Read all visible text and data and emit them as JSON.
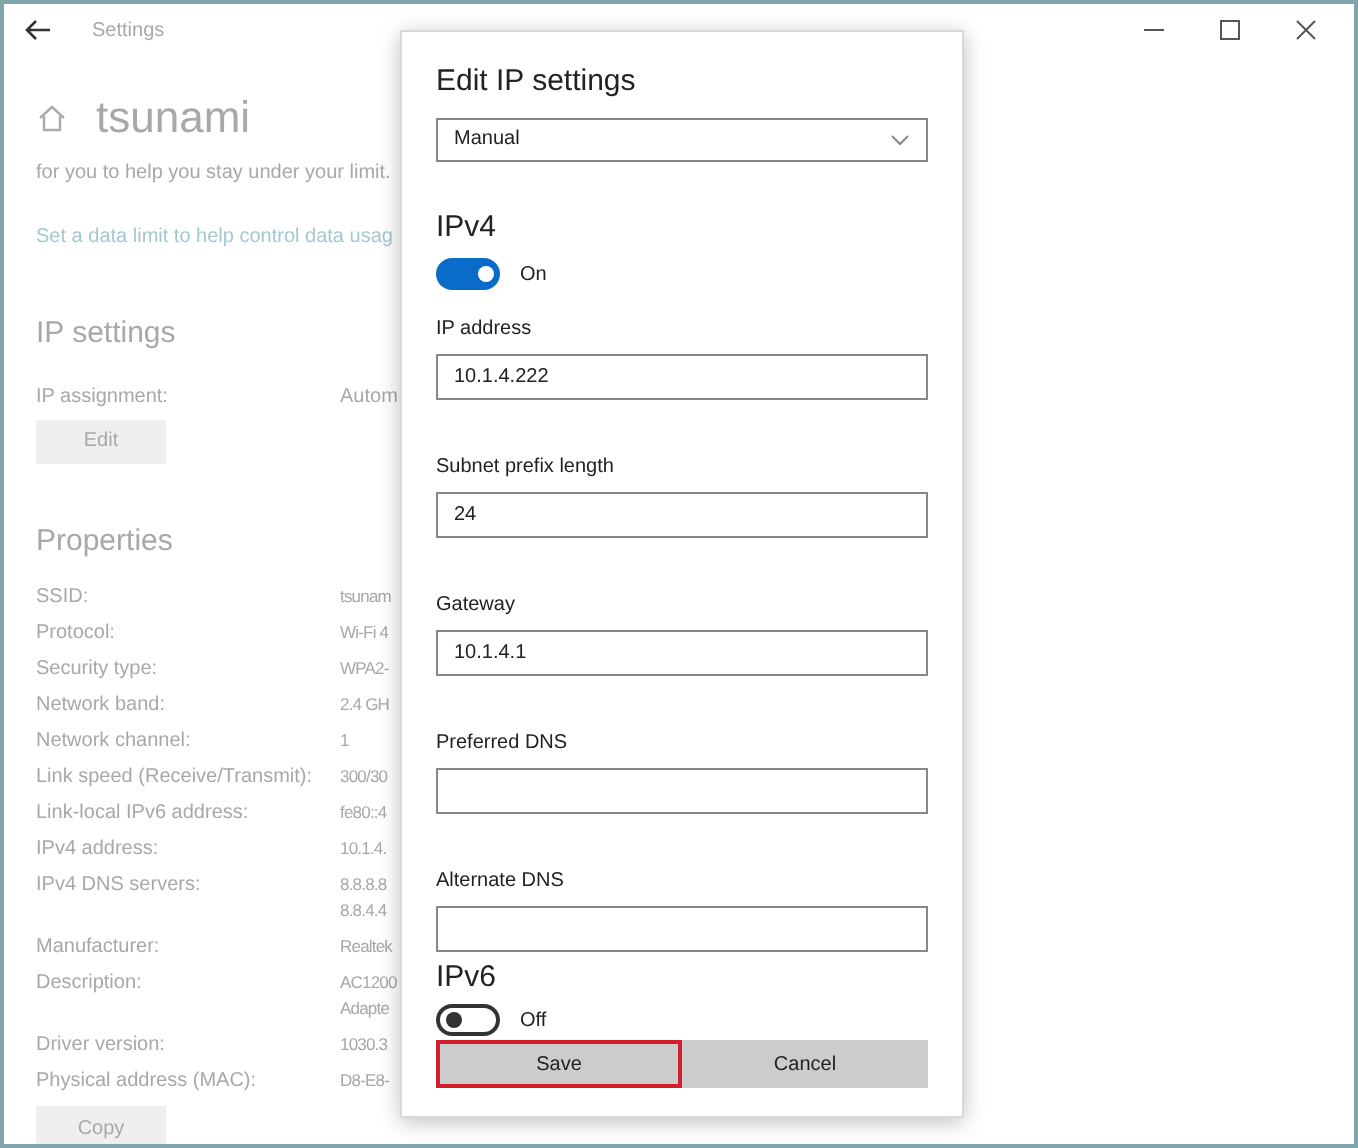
{
  "window": {
    "title": "Settings"
  },
  "page": {
    "title": "tsunami",
    "intro": "for you to help you stay under your limit.",
    "link": "Set a data limit to help control data usag"
  },
  "ip_settings": {
    "heading": "IP settings",
    "label": "IP assignment:",
    "value": "Autom",
    "button": "Edit"
  },
  "properties": {
    "heading": "Properties",
    "rows": [
      {
        "label": "SSID:",
        "value": [
          "tsunam"
        ]
      },
      {
        "label": "Protocol:",
        "value": [
          "Wi-Fi 4"
        ]
      },
      {
        "label": "Security type:",
        "value": [
          "WPA2-"
        ]
      },
      {
        "label": "Network band:",
        "value": [
          "2.4 GH"
        ]
      },
      {
        "label": "Network channel:",
        "value": [
          "1"
        ]
      },
      {
        "label": "Link speed (Receive/Transmit):",
        "value": [
          "300/30"
        ]
      },
      {
        "label": "Link-local IPv6 address:",
        "value": [
          "fe80::4"
        ]
      },
      {
        "label": "IPv4 address:",
        "value": [
          "10.1.4."
        ]
      },
      {
        "label": "IPv4 DNS servers:",
        "value": [
          "8.8.8.8",
          "8.8.4.4"
        ]
      },
      {
        "label": "Manufacturer:",
        "value": [
          "Realtek"
        ]
      },
      {
        "label": "Description:",
        "value": [
          "AC1200",
          "Adapte"
        ]
      },
      {
        "label": "Driver version:",
        "value": [
          "1030.3"
        ]
      },
      {
        "label": "Physical address (MAC):",
        "value": [
          "D8-E8-"
        ]
      }
    ],
    "button": "Copy"
  },
  "dialog": {
    "title": "Edit IP settings",
    "mode": "Manual",
    "ipv4": {
      "heading": "IPv4",
      "on": true,
      "state_label": "On",
      "fields": [
        {
          "label": "IP address",
          "value": "10.1.4.222"
        },
        {
          "label": "Subnet prefix length",
          "value": "24"
        },
        {
          "label": "Gateway",
          "value": "10.1.4.1"
        },
        {
          "label": "Preferred DNS"
        },
        {
          "label": "Alternate DNS"
        }
      ]
    },
    "ipv6": {
      "heading": "IPv6",
      "on": false,
      "state_label": "Off"
    },
    "buttons": [
      {
        "label": "Save",
        "highlighted": true
      },
      {
        "label": "Cancel",
        "highlighted": false
      }
    ]
  }
}
